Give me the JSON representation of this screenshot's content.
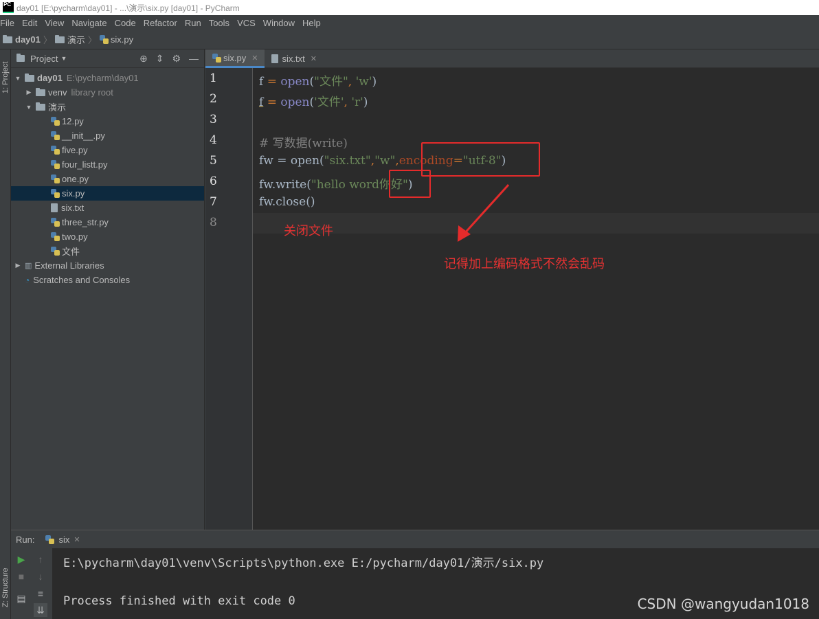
{
  "window": {
    "title": "day01 [E:\\pycharm\\day01] - ...\\演示\\six.py [day01] - PyCharm",
    "app_icon": "PC"
  },
  "menu": [
    "File",
    "Edit",
    "View",
    "Navigate",
    "Code",
    "Refactor",
    "Run",
    "Tools",
    "VCS",
    "Window",
    "Help"
  ],
  "breadcrumb": {
    "root": "day01",
    "folder": "演示",
    "file": "six.py"
  },
  "left_strip": {
    "project_tab": "1: Project",
    "structure_tab": "Z: Structure"
  },
  "project_panel": {
    "title": "Project",
    "root": {
      "name": "day01",
      "path": "E:\\pycharm\\day01"
    },
    "venv": {
      "name": "venv",
      "note": "library root"
    },
    "folder": "演示",
    "files": [
      "12.py",
      "__init__.py",
      "five.py",
      "four_listt.py",
      "one.py",
      "six.py",
      "six.txt",
      "three_str.py",
      "two.py",
      "文件"
    ],
    "selected_file": "six.py",
    "external": "External Libraries",
    "scratches": "Scratches and Consoles"
  },
  "editor": {
    "tabs": [
      {
        "label": "six.py",
        "active": true
      },
      {
        "label": "six.txt",
        "active": false
      }
    ],
    "line_numbers": [
      "1",
      "2",
      "3",
      "4",
      "5",
      "6",
      "7",
      "8"
    ],
    "lines": {
      "l1": {
        "var": "f",
        "eq": " = ",
        "fn": "open",
        "p1": "(",
        "s1": "\"文件\"",
        "c1": ", ",
        "s2": "'w'",
        "p2": ")"
      },
      "l2": {
        "var": "f",
        "eq": " = ",
        "fn": "open",
        "p1": "(",
        "s1": "'文件'",
        "c1": ", ",
        "s2": "'r'",
        "p2": ")"
      },
      "l4": {
        "comment": "# 写数据(write)"
      },
      "l5": {
        "a": "fw = open(",
        "s1": "\"six.txt\"",
        "c1": ",",
        "s2": "\"w\"",
        "c2": ",",
        "param": "encoding",
        "eq": "=",
        "s3": "\"utf-8\"",
        "p2": ")"
      },
      "l6": {
        "a": "fw.write(",
        "s1": "\"hello word你好\"",
        "p2": ")"
      },
      "l7": {
        "a": "fw.close()"
      }
    },
    "annotations": {
      "close_file": "关闭文件",
      "encoding_tip": "记得加上编码格式不然会乱码"
    }
  },
  "run": {
    "label": "Run:",
    "tab": "six",
    "lines": [
      "E:\\pycharm\\day01\\venv\\Scripts\\python.exe E:/pycharm/day01/演示/six.py",
      "",
      "Process finished with exit code 0"
    ]
  },
  "watermark": "CSDN @wangyudan1018"
}
